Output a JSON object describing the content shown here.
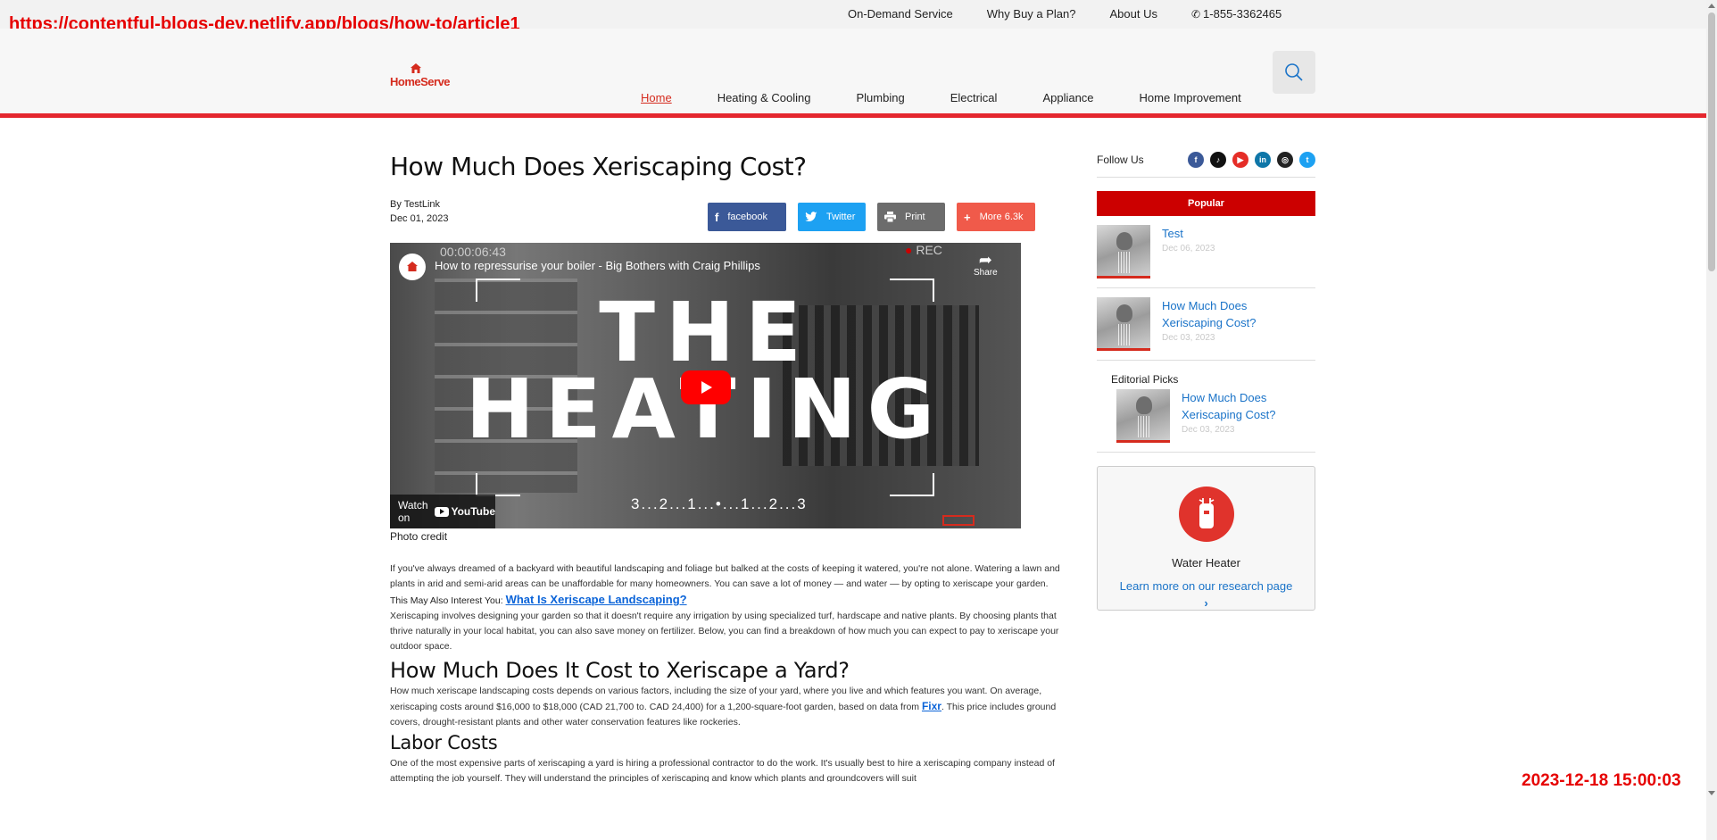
{
  "overlays": {
    "url": "https://contentful-blogs-dev.netlify.app/blogs/how-to/article1",
    "timestamp": "2023-12-18 15:00:03"
  },
  "utility": {
    "links": [
      "On-Demand Service",
      "Why Buy a Plan?",
      "About Us"
    ],
    "phone": "1-855-3362465",
    "phone_icon": "phone-icon"
  },
  "header": {
    "logo_text": "HomeServe",
    "nav": [
      {
        "label": "Home",
        "active": true
      },
      {
        "label": "Heating & Cooling",
        "active": false
      },
      {
        "label": "Plumbing",
        "active": false
      },
      {
        "label": "Electrical",
        "active": false
      },
      {
        "label": "Appliance",
        "active": false
      },
      {
        "label": "Home Improvement",
        "active": false
      }
    ],
    "search_icon": "search-icon"
  },
  "article": {
    "title": "How Much Does Xeriscaping Cost?",
    "author": "By TestLink",
    "date": "Dec 01, 2023",
    "share": {
      "facebook": "facebook",
      "twitter": "Twitter",
      "print": "Print",
      "more": "More 6.3k"
    },
    "video": {
      "timer": "00:00:06:43",
      "rec": "REC",
      "title": "How to repressurise your boiler - Big Bothers with Craig Phillips",
      "share_label": "Share",
      "big_text_line1": "THE",
      "big_text_line2": "HEATING",
      "countdown": "3...2...1...•...1...2...3",
      "watch_on": "Watch on",
      "youtube": "YouTube"
    },
    "photo_credit": "Photo credit",
    "intro": "If you've always dreamed of a backyard with beautiful landscaping and foliage but balked at the costs of keeping it watered, you're not alone. Watering a lawn and plants in arid and semi-arid areas can be unaffordable for many homeowners. You can save a lot of money — and water — by opting to xeriscape your garden.",
    "interest_prefix": "This May Also Interest You: ",
    "interest_link": "What Is Xeriscape Landscaping?",
    "para2": "Xeriscaping involves designing your garden so that it doesn't require any irrigation by using specialized turf, hardscape and native plants. By choosing plants that thrive naturally in your local habitat, you can also save money on fertilizer. Below, you can find a breakdown of how much you can expect to pay to xeriscape your outdoor space.",
    "h2": "How Much Does It Cost to Xeriscape a Yard?",
    "para3_before": "How much xeriscape landscaping costs depends on various factors, including the size of your yard, where you live and which features you want. On average, xeriscaping costs around $16,000 to $18,000 (CAD 21,700 to. CAD 24,400) for a 1,200-square-foot garden, based on data from ",
    "para3_link": "Fixr",
    "para3_after": ". This price includes ground covers, drought-resistant plants and other water conservation features like rockeries.",
    "h3": "Labor Costs",
    "para4": "One of the most expensive parts of xeriscaping a yard is hiring a professional contractor to do the work. It's usually best to hire a xeriscaping company instead of attempting the job yourself. They will understand the principles of xeriscaping and know which plants and groundcovers will suit"
  },
  "sidebar": {
    "follow_label": "Follow Us",
    "social": [
      {
        "name": "facebook-icon",
        "glyph": "f",
        "color": "#3b5998"
      },
      {
        "name": "tiktok-icon",
        "glyph": "♪",
        "color": "#111111"
      },
      {
        "name": "youtube-icon",
        "glyph": "▶",
        "color": "#e52d27"
      },
      {
        "name": "linkedin-icon",
        "glyph": "in",
        "color": "#0e76a8"
      },
      {
        "name": "instagram-icon",
        "glyph": "◎",
        "color": "#222222"
      },
      {
        "name": "twitter-icon",
        "glyph": "t",
        "color": "#1da1f2"
      }
    ],
    "popular_label": "Popular",
    "popular_items": [
      {
        "title": "Test",
        "date": "Dec 06, 2023"
      },
      {
        "title": "How Much Does Xeriscaping Cost?",
        "date": "Dec 03, 2023"
      }
    ],
    "editorial_label": "Editorial Picks",
    "editorial_items": [
      {
        "title": "How Much Does Xeriscaping Cost?",
        "date": "Dec 03, 2023"
      }
    ],
    "research": {
      "title": "Water Heater",
      "link": "Learn more on our research page",
      "chevron": "›"
    }
  },
  "colors": {
    "brand_red": "#d52b1e",
    "popular_red": "#cc0000",
    "link_blue": "#1a73c8"
  }
}
